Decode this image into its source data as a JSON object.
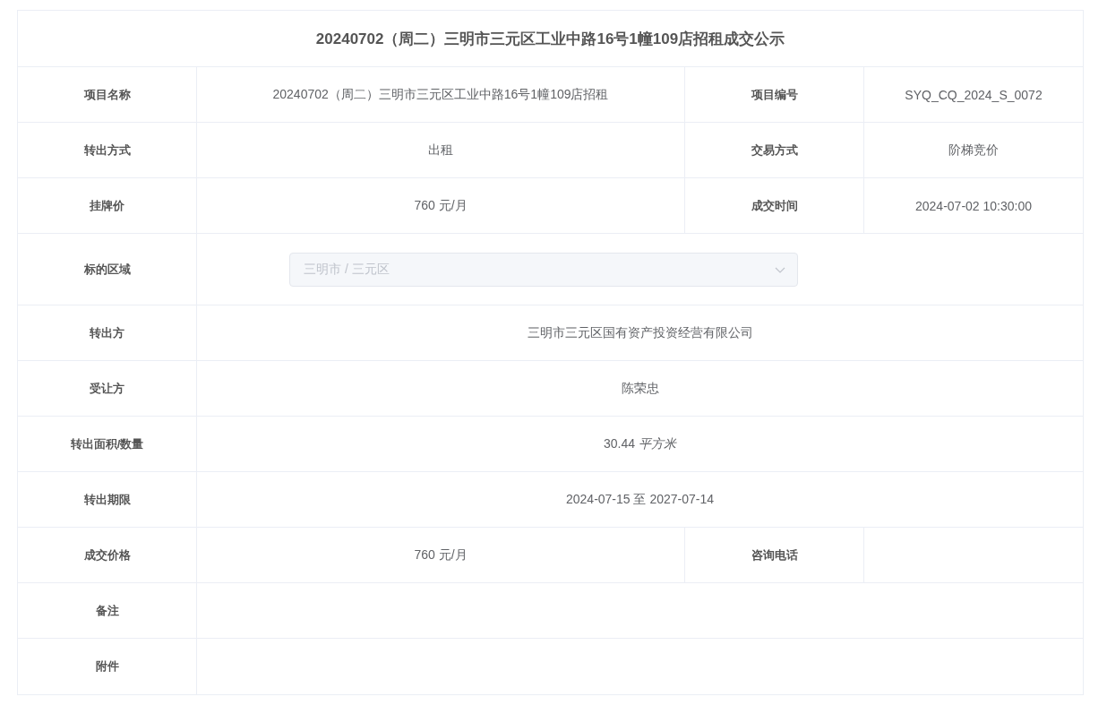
{
  "title": "20240702（周二）三明市三元区工业中路16号1幢109店招租成交公示",
  "rows": [
    {
      "kind": "pair",
      "label": "项目名称",
      "value": "20240702（周二）三明市三元区工业中路16号1幢109店招租",
      "label2": "项目编号",
      "value2": "SYQ_CQ_2024_S_0072"
    },
    {
      "kind": "pair",
      "label": "转出方式",
      "value": "出租",
      "label2": "交易方式",
      "value2": "阶梯竞价"
    },
    {
      "kind": "pair",
      "label": "挂牌价",
      "value": "760 元/月",
      "label2": "成交时间",
      "value2": "2024-07-02 10:30:00"
    },
    {
      "kind": "select",
      "label": "标的区域",
      "value": "三明市 / 三元区",
      "disabled": true
    },
    {
      "kind": "full",
      "label": "转出方",
      "value": "三明市三元区国有资产投资经营有限公司"
    },
    {
      "kind": "full",
      "label": "受让方",
      "value": "陈荣忠"
    },
    {
      "kind": "full",
      "label": "转出面积/数量",
      "value": "30.44 *平方米*"
    },
    {
      "kind": "full",
      "label": "转出期限",
      "value": "2024-07-15 至 2027-07-14"
    },
    {
      "kind": "pair",
      "label": "成交价格",
      "value": "760 元/月",
      "label2": "咨询电话"
    },
    {
      "kind": "full",
      "label": "备注"
    },
    {
      "kind": "full",
      "label": "附件"
    }
  ]
}
